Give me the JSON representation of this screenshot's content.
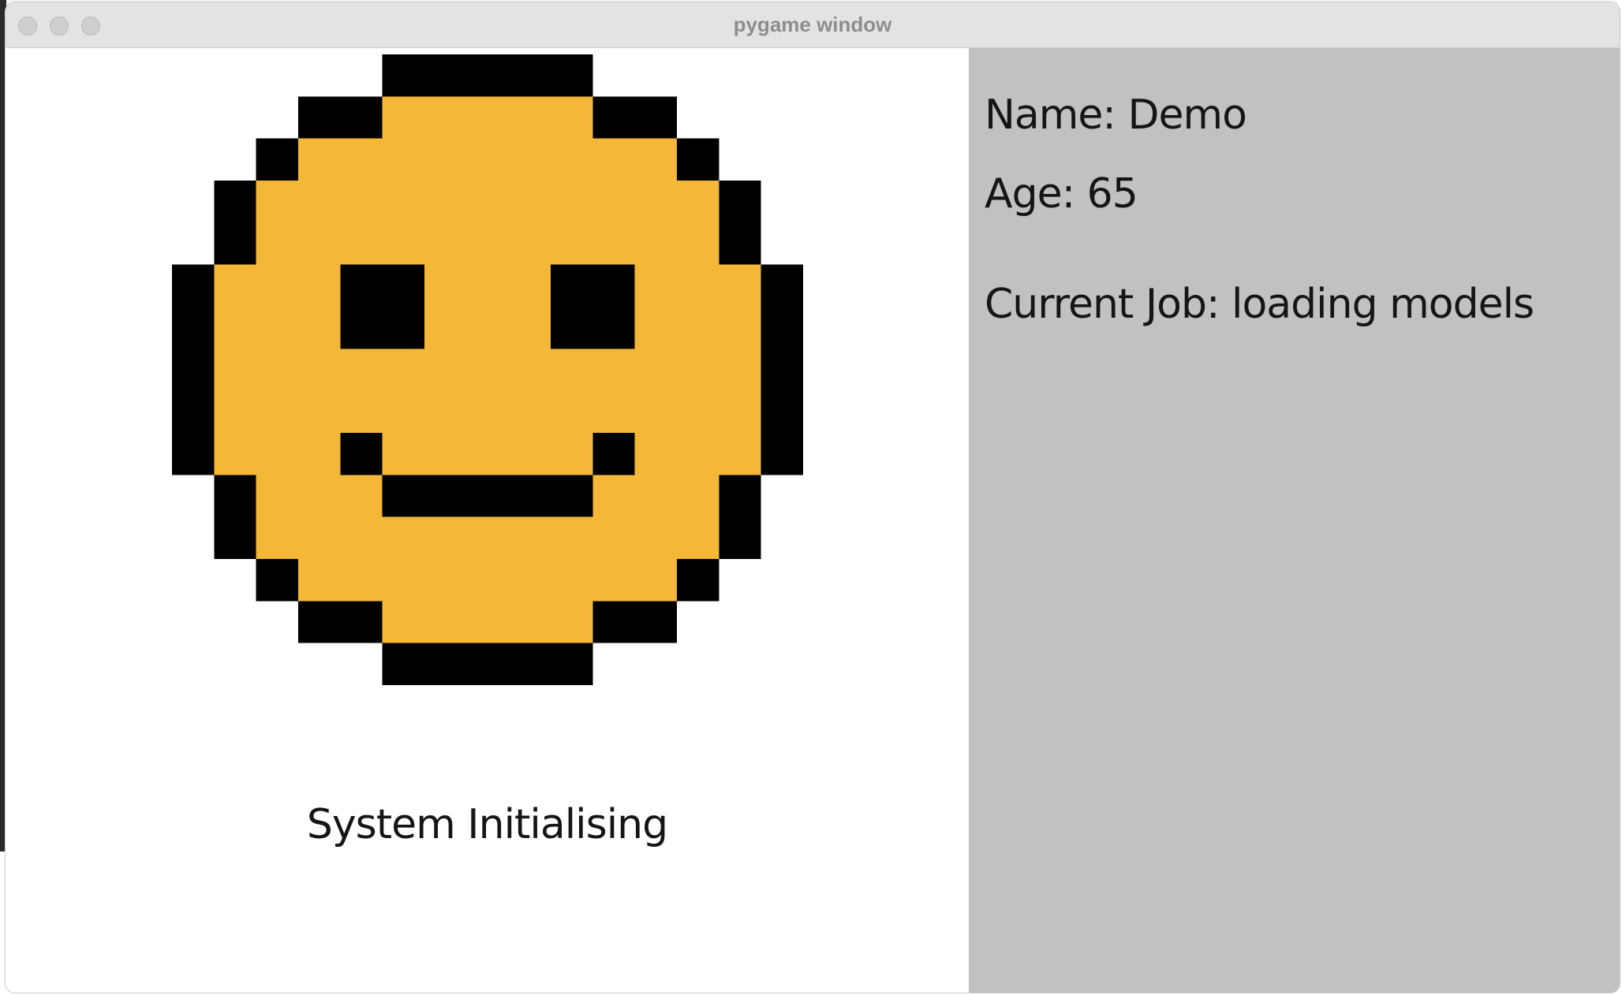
{
  "window": {
    "title": "pygame window"
  },
  "avatar": {
    "face_color": "#f4b738",
    "outline_color": "#000000",
    "background_color": "#ffffff"
  },
  "status": {
    "text": "System Initialising"
  },
  "info_panel": {
    "background_color": "#c1c1c1",
    "name_line": "Name: Demo",
    "age_line": "Age: 65",
    "job_line": "Current Job: loading models"
  }
}
